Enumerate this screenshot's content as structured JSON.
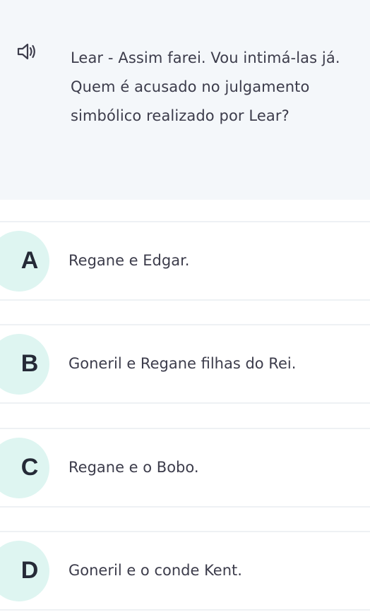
{
  "question": {
    "audio_icon": "speaker-icon",
    "text": "Lear - Assim farei. Vou intimá-las já. Quem é acusado no julgamento simbólico realizado por Lear?"
  },
  "options": [
    {
      "letter": "A",
      "text": "Regane e Edgar."
    },
    {
      "letter": "B",
      "text": "Goneril e Regane filhas do Rei."
    },
    {
      "letter": "C",
      "text": "Regane e o Bobo."
    },
    {
      "letter": "D",
      "text": "Goneril e o conde Kent."
    }
  ],
  "colors": {
    "question_panel_bg": "#f4f7fa",
    "badge_bg": "#def5f1",
    "text": "#3c3c4b",
    "letter": "#252a37",
    "divider": "#eef1f4"
  }
}
